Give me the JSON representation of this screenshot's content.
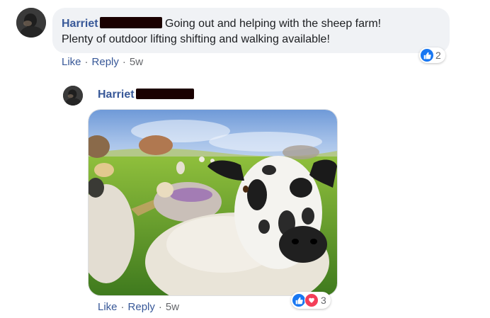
{
  "comment": {
    "author": "Harriet",
    "text_line1": "Going out and helping with the sheep farm!",
    "text_line2": "Plenty of outdoor lifting shifting and walking available!",
    "actions": {
      "like": "Like",
      "reply": "Reply",
      "age": "5w",
      "sep": "·"
    },
    "reactions": {
      "count": "2",
      "icons": [
        "like-icon"
      ]
    }
  },
  "reply": {
    "author": "Harriet",
    "photo_alt": "sheep photo",
    "actions": {
      "like": "Like",
      "reply": "Reply",
      "age": "5w",
      "sep": "·"
    },
    "reactions": {
      "count": "3",
      "icons": [
        "like-icon",
        "love-icon"
      ]
    }
  },
  "colors": {
    "name": "#385898",
    "like": "#1877f2",
    "love": "#f33e58",
    "bubble": "#f0f2f5"
  }
}
